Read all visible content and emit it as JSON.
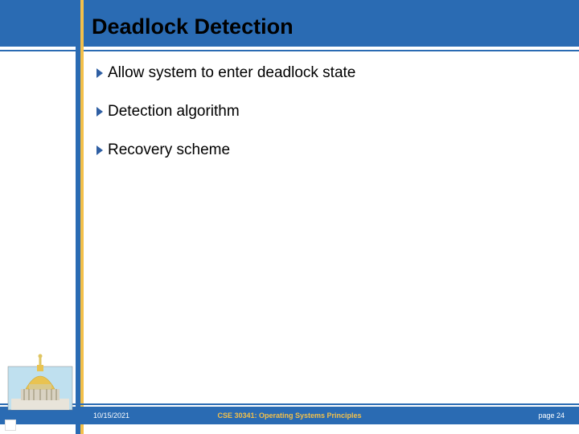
{
  "header": {
    "title": "Deadlock Detection"
  },
  "content": {
    "bullets": [
      "Allow system to enter deadlock state",
      "Detection algorithm",
      "Recovery scheme"
    ]
  },
  "footer": {
    "date": "10/15/2021",
    "course": "CSE 30341: Operating Systems Principles",
    "page_label": "page 24"
  },
  "colors": {
    "band_blue": "#2a6bb3",
    "accent_yellow": "#f3c04a"
  }
}
